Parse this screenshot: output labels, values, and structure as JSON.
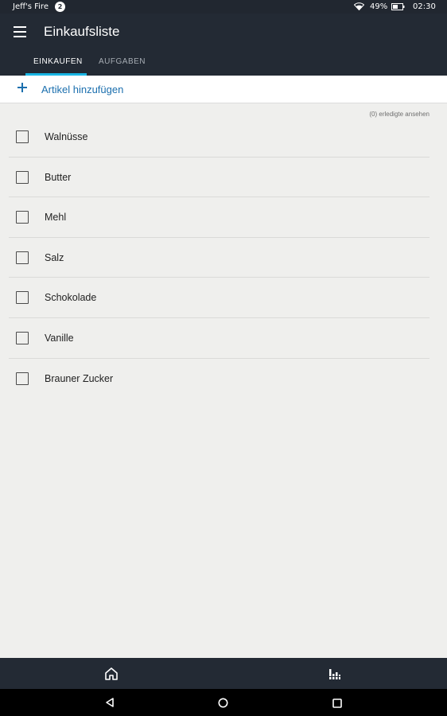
{
  "status_bar": {
    "device_name": "Jeff's Fire",
    "notification_count": "2",
    "battery_percent": "49%",
    "time": "02:30"
  },
  "app_bar": {
    "title": "Einkaufsliste",
    "tabs": [
      {
        "label": "EINKAUFEN",
        "active": true
      },
      {
        "label": "AUFGABEN",
        "active": false
      }
    ]
  },
  "add_item": {
    "label": "Artikel hinzufügen"
  },
  "completed_link": "(0) erledigte ansehen",
  "items": [
    {
      "label": "Walnüsse",
      "checked": false
    },
    {
      "label": "Butter",
      "checked": false
    },
    {
      "label": "Mehl",
      "checked": false
    },
    {
      "label": "Salz",
      "checked": false
    },
    {
      "label": "Schokolade",
      "checked": false
    },
    {
      "label": "Vanille",
      "checked": false
    },
    {
      "label": "Brauner Zucker",
      "checked": false
    }
  ],
  "colors": {
    "header": "#232a34",
    "accent": "#19b5e4",
    "link": "#1b6fae",
    "background": "#efefed"
  },
  "icons": {
    "menu": "hamburger-menu-icon",
    "add": "plus-icon",
    "home": "home-icon",
    "stats": "bar-chart-icon",
    "back": "back-triangle-icon",
    "home_system": "circle-icon",
    "recents": "square-icon"
  }
}
